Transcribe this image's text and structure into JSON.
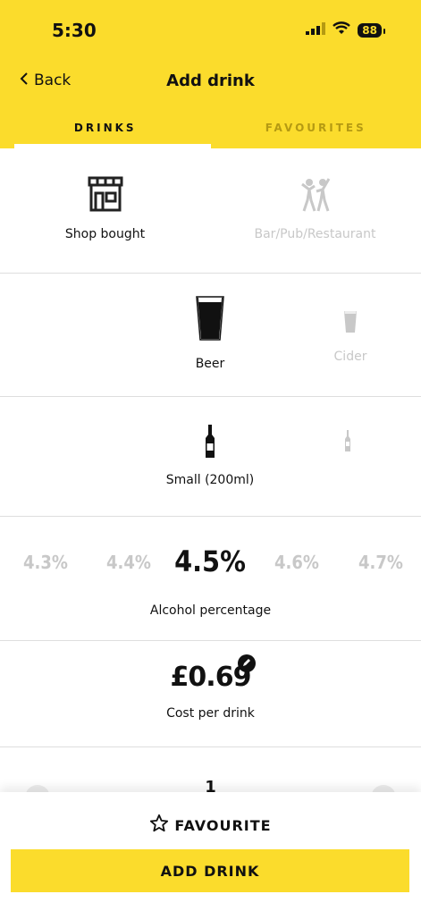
{
  "status_bar": {
    "time": "5:30",
    "battery": "88"
  },
  "nav": {
    "back_label": "Back",
    "title": "Add drink"
  },
  "tabs": [
    {
      "label": "DRINKS"
    },
    {
      "label": "FAVOURITES"
    }
  ],
  "venue": {
    "options": [
      {
        "label": "Shop bought"
      },
      {
        "label": "Bar/Pub/Restaurant"
      }
    ]
  },
  "drink_type": {
    "items": [
      {
        "label": "Beer"
      },
      {
        "label": "Cider"
      }
    ]
  },
  "size": {
    "label": "Small (200ml)"
  },
  "abv": {
    "values": [
      "4.3%",
      "4.4%",
      "4.5%",
      "4.6%",
      "4.7%"
    ],
    "label": "Alcohol percentage"
  },
  "cost": {
    "value": "£0.69",
    "label": "Cost per drink"
  },
  "quantity": {
    "value": "1"
  },
  "actions": {
    "favourite_label": "FAVOURITE",
    "add_label": "ADD DRINK"
  },
  "colors": {
    "brand_yellow": "#fbdc2c",
    "muted_text": "#c8c8c8"
  }
}
